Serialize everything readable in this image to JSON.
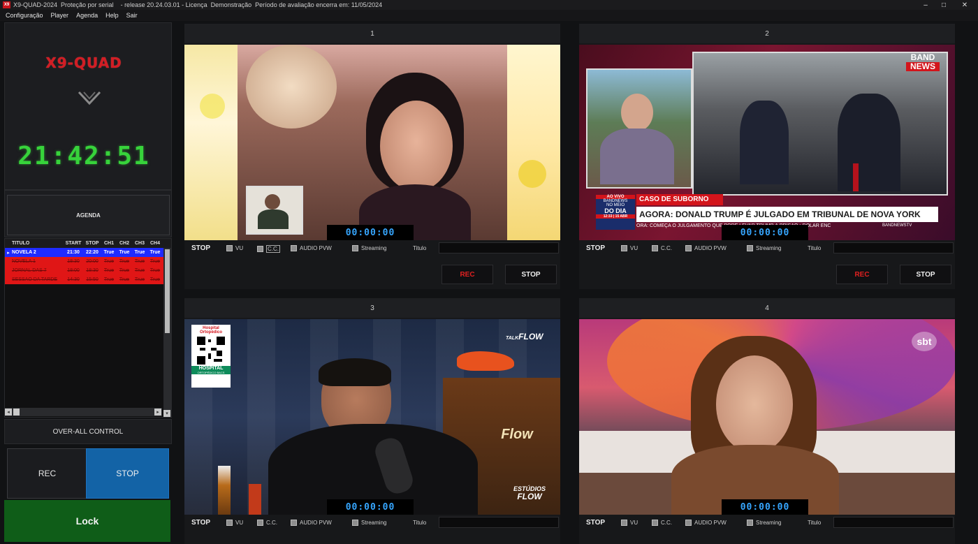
{
  "window": {
    "title": "X9-QUAD-2024  Proteção por serial    - release 20.24.03.01 - Licença  Demonstração  Período de avaliação encerra em: 11/05/2024",
    "icon_label": "X9",
    "controls": [
      "–",
      "□",
      "✕"
    ]
  },
  "menu": [
    "Configuração",
    "Player",
    "Agenda",
    "Help",
    "Sair"
  ],
  "left": {
    "logo": "X9-QUAD",
    "clock": "21:42:51",
    "agenda_button": "AGENDA",
    "schedule": {
      "columns": [
        "TÍTULO",
        "START",
        "STOP",
        "CH1",
        "CH2",
        "CH3",
        "CH4"
      ],
      "rows": [
        {
          "cells": [
            "NOVELA 2",
            "21:30",
            "22:20",
            "True",
            "True",
            "True",
            "True"
          ],
          "state": "selected"
        },
        {
          "cells": [
            "NOVELA 1",
            "18:30",
            "20:00",
            "True",
            "True",
            "True",
            "True"
          ],
          "state": "done"
        },
        {
          "cells": [
            "JORNAL DAS 7",
            "18:00",
            "18:30",
            "True",
            "True",
            "True",
            "True"
          ],
          "state": "done"
        },
        {
          "cells": [
            "SESSÃO DA TARDE",
            "14:30",
            "15:50",
            "True",
            "True",
            "True",
            "True"
          ],
          "state": "done"
        }
      ]
    },
    "over_all_label": "OVER-ALL CONTROL",
    "rec_label": "REC",
    "stop_label": "STOP",
    "lock_label": "Lock"
  },
  "controls_labels": {
    "stop": "STOP",
    "vu": "VU",
    "cc": "C.C.",
    "audio_pvw": "AUDIO PVW",
    "streaming": "Streaming",
    "titulo": "Titulo",
    "rec": "REC",
    "stop_button": "STOP"
  },
  "channels": [
    {
      "number": "1",
      "timecode": "00:00:00"
    },
    {
      "number": "2",
      "timecode": "00:00:00"
    },
    {
      "number": "3",
      "timecode": "00:00:00"
    },
    {
      "number": "4",
      "timecode": "00:00:00"
    }
  ],
  "overlays": {
    "ch2": {
      "logo_top": "BAND",
      "logo_bottom": "NEWS",
      "live": "AO VIVO",
      "network": "BANDNEWS",
      "program_small": "NO MEIO",
      "program": "DO DIA",
      "time": "12:33 | 15 ABR",
      "topic": "CASO DE SUBORNO",
      "headline": "AGORA: DONALD TRUMP É JULGADO EM TRIBUNAL DE NOVA YORK",
      "ticker": "ORA: COMEÇA O JULGAMENTO QUE PODE LEVAR TRUMP À PRISÃO    •    DÓLAR ENC",
      "handle": "BANDNEWSTV"
    },
    "ch3": {
      "hospital_top": "Hospital Ortopédico",
      "hospital_bottom": "HOSPITAL",
      "hospital_sub": "ORTOPÉDICO BACS",
      "talk": "TALK",
      "flow": "FLOW",
      "studio_top": "ESTÚDIOS",
      "studio_bottom": "FLOW",
      "sign": "Flow"
    },
    "ch4": {
      "logo": "sbt"
    }
  },
  "colors": {
    "clock": "#37d33b",
    "logo": "#d21d24",
    "timecode": "#36a6ff",
    "selected_row": "#1f2bff",
    "done_row": "#e01616",
    "stop_active": "#1363a6",
    "lock": "#0f5d18"
  }
}
